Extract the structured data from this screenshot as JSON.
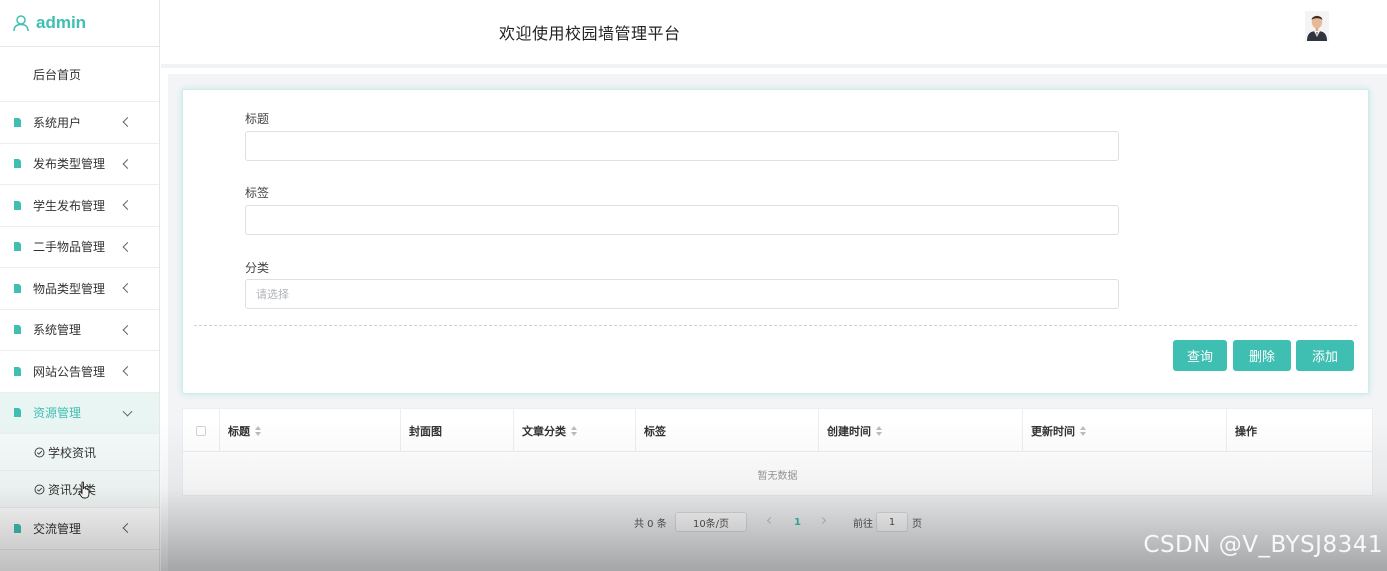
{
  "brand": {
    "name": "admin"
  },
  "header": {
    "title": "欢迎使用校园墙管理平台"
  },
  "sidebar": {
    "home": "后台首页",
    "items": [
      {
        "label": "系统用户"
      },
      {
        "label": "发布类型管理"
      },
      {
        "label": "学生发布管理"
      },
      {
        "label": "二手物品管理"
      },
      {
        "label": "物品类型管理"
      },
      {
        "label": "系统管理"
      },
      {
        "label": "网站公告管理"
      },
      {
        "label": "资源管理"
      }
    ],
    "subitems": [
      {
        "label": "学校资讯"
      },
      {
        "label": "资讯分类"
      }
    ],
    "last_item": {
      "label": "交流管理"
    }
  },
  "search": {
    "title_label": "标题",
    "tag_label": "标签",
    "category_label": "分类",
    "category_placeholder": "请选择"
  },
  "buttons": {
    "query": "查询",
    "delete": "删除",
    "add": "添加"
  },
  "table": {
    "columns": [
      "标题",
      "封面图",
      "文章分类",
      "标签",
      "创建时间",
      "更新时间",
      "操作"
    ],
    "empty_text": "暂无数据"
  },
  "pagination": {
    "total": "共 0 条",
    "page_size": "10条/页",
    "current_page": "1",
    "goto_label": "前往",
    "goto_value": "1",
    "page_unit": "页"
  },
  "watermark": "CSDN @V_BYSJ8341",
  "colors": {
    "accent": "#3fbfb2",
    "active_bg": "#e9f5f3"
  }
}
